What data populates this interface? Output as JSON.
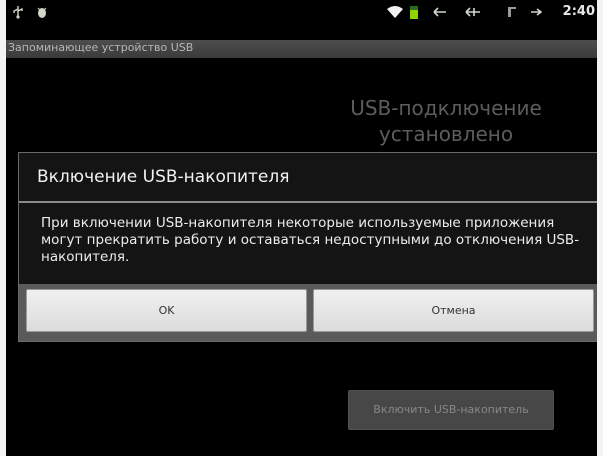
{
  "status_bar": {
    "clock": "2:40",
    "icons": [
      "usb-icon",
      "bug-icon",
      "wifi-icon",
      "battery-icon",
      "arrow-left-icon",
      "arrow-double-icon",
      "signal-icon",
      "arrow-right-icon"
    ]
  },
  "window": {
    "title": "Запоминающее устройство USB"
  },
  "background": {
    "heading_line1": "USB-подключение",
    "heading_line2": "установлено",
    "enable_button_label": "Включить USB-накопитель"
  },
  "dialog": {
    "title": "Включение USB-накопителя",
    "message": "При включении USB-накопителя некоторые используемые приложения могут прекратить работу и оставаться недоступными до отключения USB-накопителя.",
    "ok_label": "OK",
    "cancel_label": "Отмена"
  },
  "colors": {
    "background": "#000000",
    "dialog_button_bg": "#e8e8e8",
    "title_bar": "#444444"
  }
}
